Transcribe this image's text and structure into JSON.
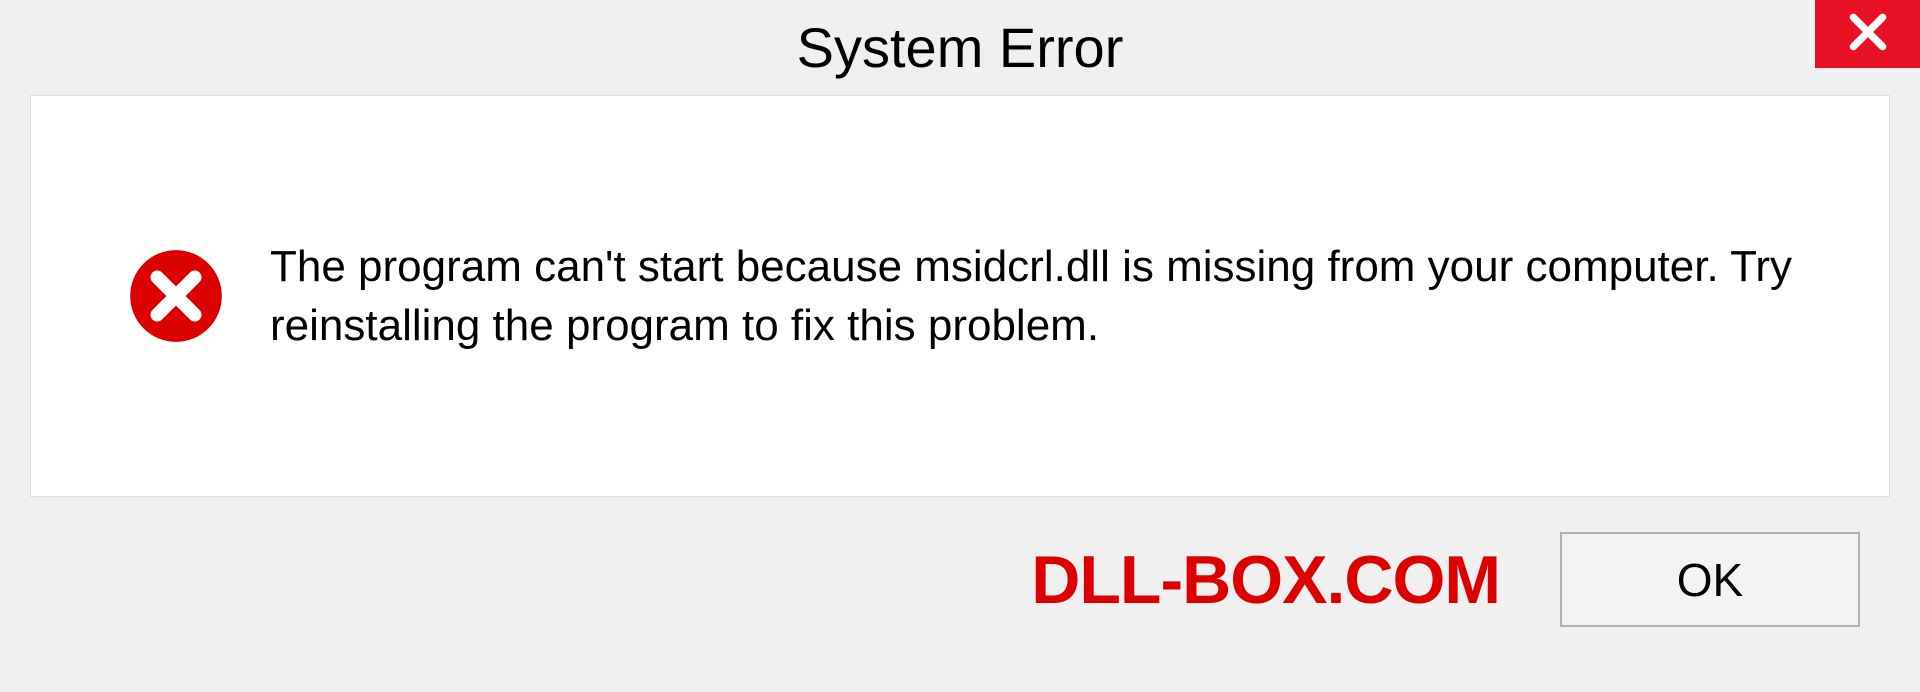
{
  "dialog": {
    "title": "System Error",
    "message": "The program can't start because msidcrl.dll is missing from your computer. Try reinstalling the program to fix this problem.",
    "ok_label": "OK"
  },
  "watermark": "DLL-BOX.COM",
  "colors": {
    "close_bg": "#e81123",
    "error_red": "#dc0000"
  }
}
